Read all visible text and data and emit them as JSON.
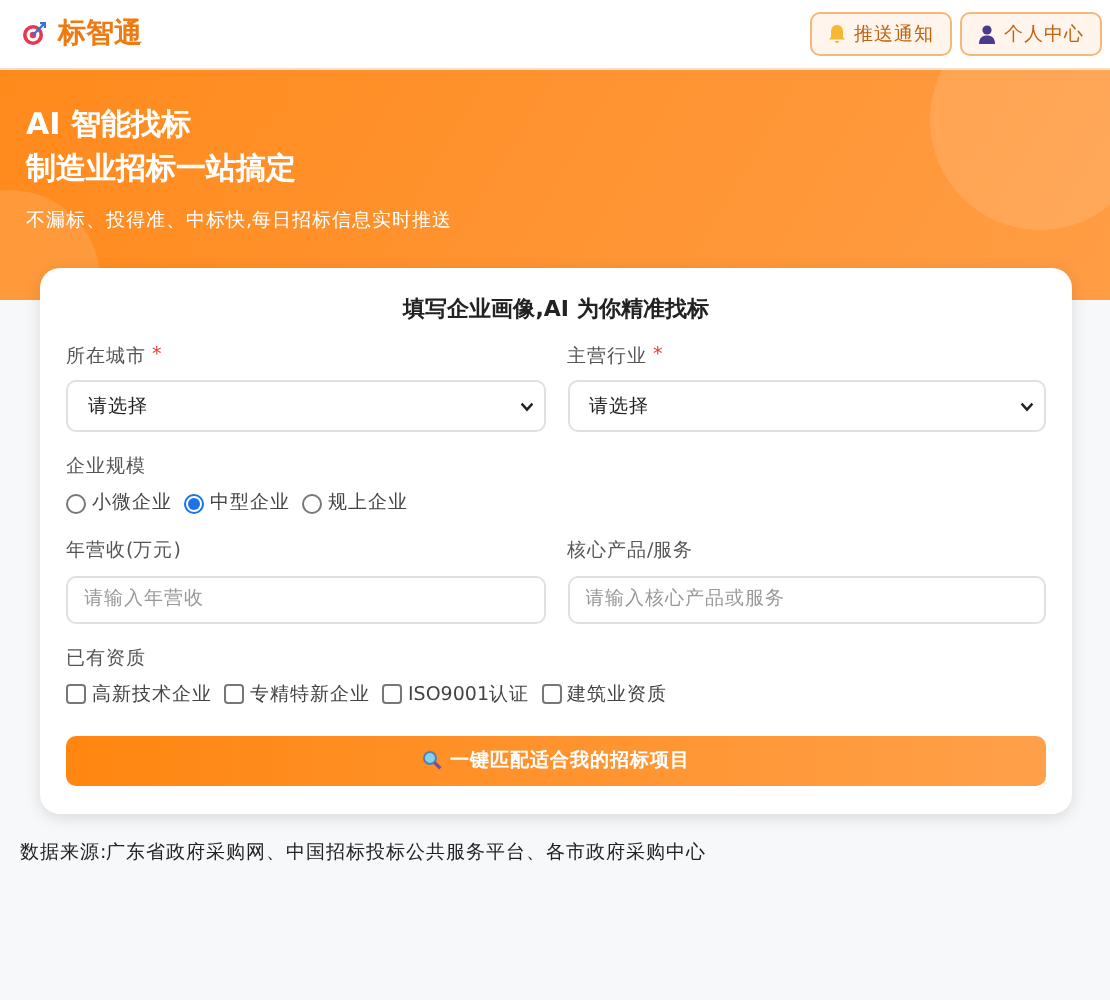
{
  "header": {
    "logo_text": "标智通",
    "buttons": [
      {
        "kind": "bell",
        "label": "推送通知"
      },
      {
        "kind": "user",
        "label": "个人中心"
      }
    ]
  },
  "hero": {
    "title_lines": [
      "AI 智能找标",
      "制造业招标一站搞定"
    ],
    "subtitle": "不漏标、投得准、中标快,每日招标信息实时推送"
  },
  "form": {
    "title": "填写企业画像,AI 为你精准找标",
    "selects": [
      {
        "label": "所在城市",
        "required_mark": "*",
        "value": "请选择"
      },
      {
        "label": "主营行业",
        "required_mark": "*",
        "value": "请选择"
      }
    ],
    "scale": {
      "label": "企业规模",
      "options": [
        {
          "label": "小微企业",
          "selected": false
        },
        {
          "label": "中型企业",
          "selected": true
        },
        {
          "label": "规上企业",
          "selected": false
        }
      ]
    },
    "inputs": [
      {
        "label": "年营收(万元)",
        "placeholder": "请输入年营收"
      },
      {
        "label": "核心产品/服务",
        "placeholder": "请输入核心产品或服务"
      }
    ],
    "qualifications": {
      "label": "已有资质",
      "options": [
        {
          "label": "高新技术企业",
          "checked": false
        },
        {
          "label": "专精特新企业",
          "checked": false
        },
        {
          "label": "ISO9001认证",
          "checked": false
        },
        {
          "label": "建筑业资质",
          "checked": false
        }
      ]
    },
    "submit": "一键匹配适合我的招标项目"
  },
  "footer": "数据来源:广东省政府采购网、中国招标投标公共服务平台、各市政府采购中心"
}
